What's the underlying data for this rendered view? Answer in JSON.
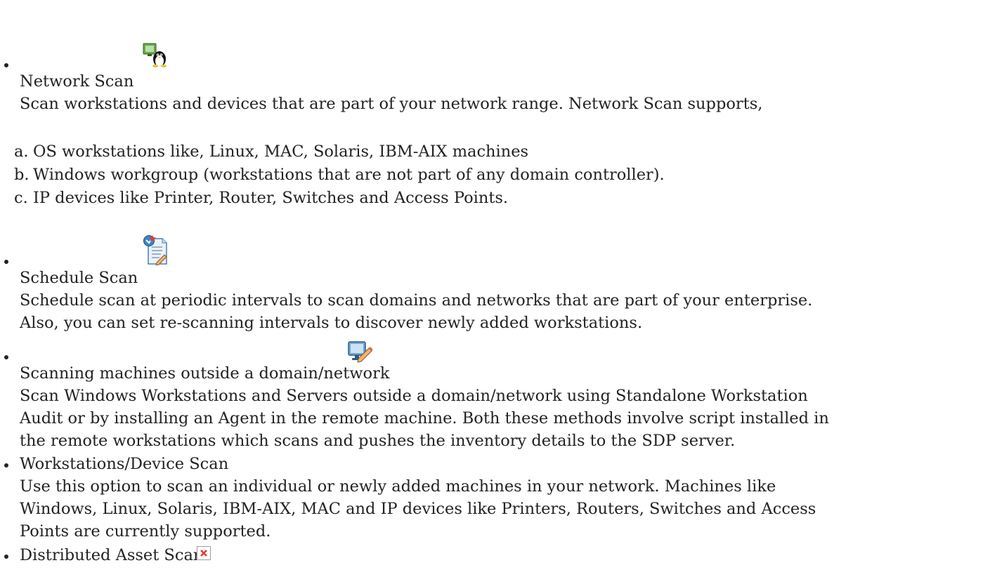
{
  "items": [
    {
      "title": "Network Scan",
      "icon": "linux-tux-network-icon",
      "description": [
        "Scan workstations and devices that are part of your network range. Network Scan supports,"
      ],
      "sublist": [
        {
          "marker": "a.",
          "text": "OS workstations like, Linux, MAC, Solaris, IBM-AIX machines"
        },
        {
          "marker": "b.",
          "text": "Windows workgroup (workstations that are not part of any domain controller)."
        },
        {
          "marker": "c.",
          "text": "IP devices like Printer, Router, Switches and Access Points."
        }
      ]
    },
    {
      "title": "Schedule Scan",
      "icon": "schedule-document-icon",
      "description": [
        "Schedule scan at periodic intervals to scan domains and networks that are part of your enterprise.",
        "Also, you can set re-scanning intervals to  discover newly added workstations."
      ]
    },
    {
      "title": "Scanning machines outside a domain/network",
      "icon": "monitor-edit-icon",
      "description": [
        "Scan Windows Workstations and Servers outside a domain/network using Standalone Workstation",
        "Audit or by installing an Agent in the remote machine. Both these methods involve script installed in",
        "the remote workstations which scans and pushes the inventory details to the SDP server."
      ]
    },
    {
      "title": "Workstations/Device Scan",
      "description": [
        "Use this option to scan an individual or newly added machines in your network. Machines like",
        "Windows, Linux, Solaris, IBM-AIX, MAC and IP devices like Printers, Routers, Switches and Access",
        "Points are currently supported."
      ]
    },
    {
      "title": "Distributed Asset Scan",
      "icon": "broken-image-icon"
    }
  ]
}
